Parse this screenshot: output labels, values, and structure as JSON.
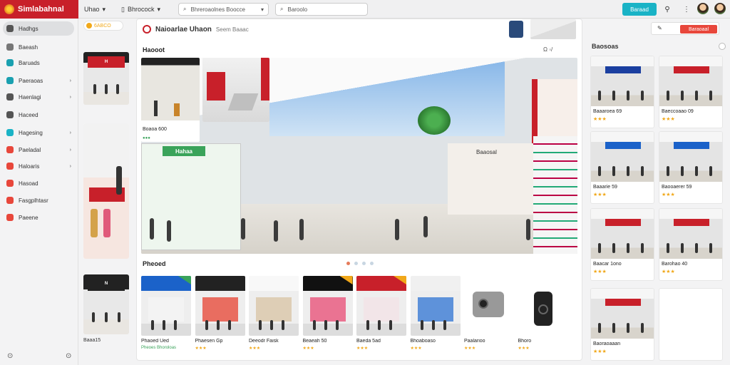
{
  "app": {
    "title": "Simlabahnal"
  },
  "topbar": {
    "menu_label": "Uhao",
    "tab_label": "Bhrocock",
    "search_placeholder": "Bhreroaolnes Boocce",
    "search2_placeholder": "Baroolo",
    "primary_button": "Baraad"
  },
  "sidebar": {
    "items": [
      {
        "label": "Hadhgs",
        "color": "#555555"
      },
      {
        "label": "Baeash",
        "color": "#777777"
      },
      {
        "label": "Baruads",
        "color": "#1aa0b0"
      },
      {
        "label": "Paeraoas",
        "color": "#1aa0b0"
      },
      {
        "label": "Haenlagi",
        "color": "#555555"
      },
      {
        "label": "Haceed",
        "color": "#555555"
      },
      {
        "label": "Hagesing",
        "color": "#1ab3c6"
      },
      {
        "label": "Paeladal",
        "color": "#e8473b"
      },
      {
        "label": "Haloaris",
        "color": "#e8473b"
      },
      {
        "label": "Hasoad",
        "color": "#e8473b"
      },
      {
        "label": "Fasgplhtasr",
        "color": "#e8473b"
      },
      {
        "label": "Paeene",
        "color": "#e8473b"
      }
    ]
  },
  "leftcol": {
    "promo": "6ABCO"
  },
  "main": {
    "header_title": "Naioarlae Uhaon",
    "header_subtitle": "Seem Baaac",
    "featured_title": "Haooot",
    "featured_controls": "Ω ◦/",
    "hero_sign_left": "Hahaa",
    "hero_sign_center": "Baaosal",
    "inset_caption": "Boaoa 600",
    "products_title": "Pheoed",
    "products": [
      {
        "name": "Phaoed Ued",
        "meta": "Pheoes  Bhoroloas"
      },
      {
        "name": "Phaesen Gp",
        "meta": "★★★"
      },
      {
        "name": "Deeodr Faisk",
        "meta": "★★★"
      },
      {
        "name": "Beaeah 50",
        "meta": "★★★"
      },
      {
        "name": "Baeda 5ad",
        "meta": "★★★"
      },
      {
        "name": "Bhoaboaso",
        "meta": "★★★"
      },
      {
        "name": "Paalarioo",
        "meta": "★★★"
      },
      {
        "name": "Bhoro",
        "meta": "★★★"
      }
    ]
  },
  "rightcol": {
    "title": "Baosoas",
    "button": "Baraoaal",
    "cards": [
      {
        "name": "Baaaroea 69",
        "stars": "★★★"
      },
      {
        "name": "Baeccoaao 09",
        "stars": "★★★"
      },
      {
        "name": "Baaarie 59",
        "stars": "★★★"
      },
      {
        "name": "Baooaerer 59",
        "stars": "★★★"
      },
      {
        "name": "Baacar 1ono",
        "stars": "★★★"
      },
      {
        "name": "Barohao 40",
        "stars": "★★★"
      },
      {
        "name": "Baoraoaaan",
        "stars": "★★★"
      }
    ]
  },
  "colors": {
    "brand": "#c8202a",
    "accent": "#1ab3c6",
    "cta": "#e8473b"
  }
}
